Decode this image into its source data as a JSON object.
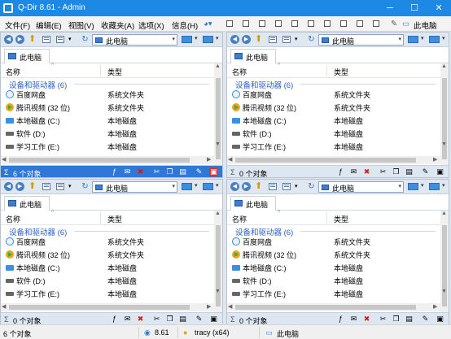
{
  "window": {
    "title": "Q-Dir 8.61 - Admin",
    "min": "─",
    "max": "☐",
    "close": "✕"
  },
  "menu": {
    "file": "文件(F)",
    "edit": "编辑(E)",
    "view": "视图(V)",
    "favorites": "收藏夹(A)",
    "options": "选项(X)",
    "info": "信息(H)",
    "location": "此电脑"
  },
  "columns": {
    "name": "名称",
    "type": "类型"
  },
  "group": "设备和驱动器 (6)",
  "address": "此电脑",
  "tab": "此电脑",
  "rows": [
    {
      "name": "百度网盘",
      "type": "系统文件夹",
      "icon": "cloud-icon"
    },
    {
      "name": "腾讯视频 (32 位)",
      "type": "系统文件夹",
      "icon": "video-icon"
    },
    {
      "name": "本地磁盘 (C:)",
      "type": "本地磁盘",
      "icon": "disk-icon"
    },
    {
      "name": "软件 (D:)",
      "type": "本地磁盘",
      "icon": "disk-icon"
    },
    {
      "name": "学习工作 (E:)",
      "type": "本地磁盘",
      "icon": "disk-icon"
    }
  ],
  "panes": [
    {
      "count": "6 个对象",
      "active": true
    },
    {
      "count": "0 个对象",
      "active": false
    },
    {
      "count": "0 个对象",
      "active": false
    },
    {
      "count": "0 个对象",
      "active": false
    }
  ],
  "statusbar": {
    "objects": "6 个对象",
    "version": "8.61",
    "user": "tracy (x64)",
    "location": "此电脑"
  },
  "colors": {
    "titlebar": "#1e88e5",
    "active_status": "#2f78d8",
    "group": "#2a62c9"
  }
}
